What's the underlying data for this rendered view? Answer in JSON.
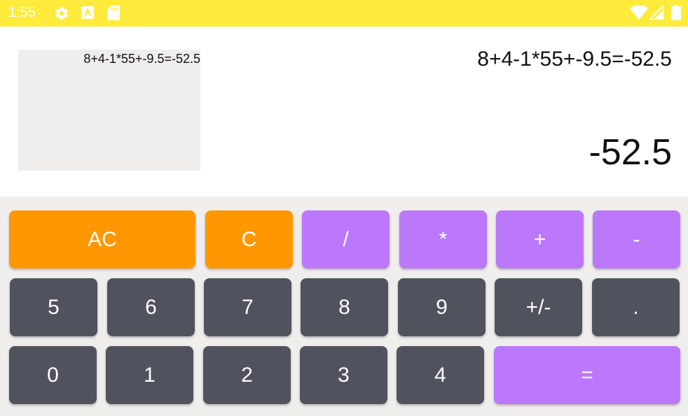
{
  "status_bar": {
    "time": "1:55",
    "icons": [
      "gear-icon",
      "font-a-icon",
      "sd-card-icon",
      "wifi-icon",
      "signal-icon",
      "battery-icon"
    ]
  },
  "display": {
    "history_text": "8+4-1*55+-9.5=-52.5",
    "expression": "8+4-1*55+-9.5=-52.5",
    "result": "-52.5"
  },
  "keys": {
    "ac": "AC",
    "c": "C",
    "divide": "/",
    "multiply": "*",
    "plus": "+",
    "minus": "-",
    "five": "5",
    "six": "6",
    "seven": "7",
    "eight": "8",
    "nine": "9",
    "plus_minus": "+/-",
    "dot": ".",
    "zero": "0",
    "one": "1",
    "two": "2",
    "three": "3",
    "four": "4",
    "equals": "="
  },
  "colors": {
    "status_bar": "#ffeb3b",
    "clear_keys": "#ff9800",
    "operator_keys": "#bb78fa",
    "digit_keys": "#50535e",
    "keypad_background": "#f0eded"
  }
}
